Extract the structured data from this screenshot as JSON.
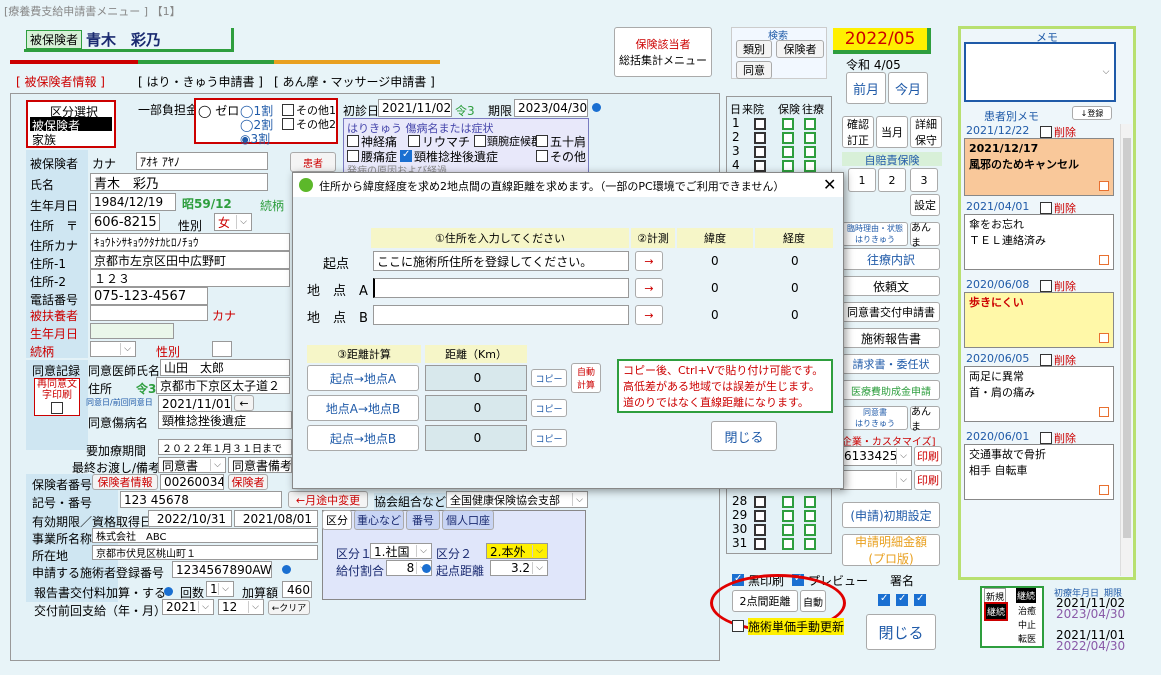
{
  "window_title": "[療養費支給申請書メニュー ]  【1】",
  "patient": {
    "label": "被保険者",
    "name": "青木　彩乃"
  },
  "menu_button": {
    "line1": "保険該当者",
    "line2": "総括集計メニュー"
  },
  "search": {
    "title": "検索",
    "b1": "類別",
    "b2": "保険者",
    "b3": "同意"
  },
  "date_badge": "2022/05",
  "era_date": "令和 4/05",
  "tabs": [
    "[ 被保険者情報 ]",
    "[ はり・きゅう申請書 ]",
    "[ あん摩・マッサージ申請書 ]"
  ],
  "kubun": {
    "title": "区分選択",
    "opt1": "被保険者",
    "opt2": "家族"
  },
  "futan": {
    "label": "一部負担金",
    "r0": "ゼロ",
    "r1": "1割",
    "r2": "2割",
    "r3": "3割",
    "o1": "その他1",
    "o2": "その他2"
  },
  "shoken": {
    "label": "初診日",
    "date": "2021/11/02",
    "era": "令3",
    "kigen_label": "期限",
    "kigen": "2023/04/30"
  },
  "shobyo": {
    "title": "はりきゅう 傷病名または症状",
    "c1": "神経痛",
    "c2": "リウマチ",
    "c3": "頸腕症候群",
    "c4": "五十肩",
    "c5": "腰痛症",
    "c6": "頸椎捻挫後遺症",
    "c7": "その他",
    "c8": "発病の原因および経過"
  },
  "fields": {
    "hihoken": "被保険者",
    "kana_label": "カナ",
    "kana": "ｱｵｷ ｱﾔﾉ",
    "name_label": "氏名",
    "name": "青木　彩乃",
    "birth_label": "生年月日",
    "birth": "1984/12/19",
    "birth_era": "昭59/12",
    "zokugara": "続柄",
    "addr_label": "住所　〒",
    "zip": "606-8215",
    "sex_label": "性別",
    "sex": "女",
    "addr_kana_label": "住所カナ",
    "addr_kana": "ｷｮｳﾄｼｻｷｮｳｸﾀﾅｶﾋﾛﾉﾁｮｳ",
    "addr1_label": "住所-1",
    "addr1": "京都市左京区田中広野町",
    "addr2_label": "住所-2",
    "addr2": "１２３",
    "tel_label": "電話番号",
    "tel": "075-123-4567",
    "fuyo_label": "被扶養者",
    "kana2": "カナ",
    "birth2": "生年月日",
    "zoku2": "続柄",
    "sex2": "性別",
    "patient_btn": "患者"
  },
  "doi": {
    "record": "同意記録",
    "doctor_label": "同意医師氏名",
    "doctor": "山田　太郎",
    "print_label": "再同意文字印刷",
    "addr_label": "住所",
    "addr_era": "令3",
    "addr": "京都市下京区太子道２",
    "date_label": "同意日/前回同意日",
    "date": "2021/11/01",
    "byomei_label": "同意傷病名",
    "byomei": "頸椎捻挫後遺症",
    "yokaryo_label": "要加療期間",
    "yokaryo": "２０２２年１月３１日まで",
    "saishu_label": "最終お渡し/備考",
    "saishu": "同意書",
    "saishu2": "同意書備考"
  },
  "hoken": {
    "no_label": "保険者番号",
    "no_btn": "保険者情報",
    "no": "00260034",
    "hokensha": "保険者",
    "kigo_label": "記号・番号",
    "kigo": "123 45678",
    "tochu": "←月途中変更",
    "kumiai_label": "協会組合など",
    "kumiai": "全国健康保険協会支部",
    "yuko_label": "有効期限／資格取得日",
    "yuko1": "2022/10/31",
    "yuko2": "2021/08/01",
    "jigyo_label": "事業所名称",
    "jigyo": "株式会社　ABC",
    "shozai_label": "所在地",
    "shozai": "京都市伏見区桃山町１",
    "sekou_label": "申請する施術者登録番号",
    "sekou": "1234567890AW",
    "hokoku_label": "報告書交付料加算・する",
    "kaisu_label": "回数",
    "kaisu": "1",
    "kasan_label": "加算額",
    "kasan": "460",
    "zenkai_label": "交付前回支給（年・月）",
    "zen_y": "2021",
    "zen_m": "12",
    "clear": "←クリア"
  },
  "subtabs": [
    "区分",
    "重心など",
    "番号",
    "個人口座"
  ],
  "kubun_panel": {
    "k1_label": "区分１",
    "k1": "1.社国",
    "k2_label": "区分２",
    "k2": "2.本外",
    "kyufu_label": "給付割合",
    "kyufu": "8",
    "kiten_label": "起点距離",
    "kiten": "3.2"
  },
  "calendar": {
    "h1": "日",
    "h2": "来院",
    "h3": "保険",
    "h4": "往療",
    "days": [
      "1",
      "2",
      "3",
      "4",
      "28",
      "29",
      "30",
      "31"
    ]
  },
  "right_menu": {
    "kakunin": "確認",
    "teisei": "訂正",
    "tougetsu": "当月",
    "shosai": "詳細",
    "hozon": "保守",
    "jibai": "自賠責保険",
    "j1": "1",
    "j2": "2",
    "j3": "3",
    "settei": "設定",
    "riyu": "臨時理由・状態",
    "hari1": "はりきゅう",
    "anma1": "あんま",
    "ouryo": "往療内訳",
    "irai": "依頼文",
    "doisho": "同意書交付申請書",
    "hokokusho": "施術報告書",
    "seikyu": "請求書・委任状",
    "iryohi": "医療費助成金申請",
    "doisho2": "同意書",
    "hari2": "はりきゅう",
    "anma2": "あんま",
    "kigyo": "[企業・カスタマイズ]",
    "code": "6133425",
    "insatsu": "印刷",
    "insatsu2": "印刷",
    "shoki": "(申請)初期設定",
    "meisai1": "申請明細金額",
    "meisai2": "(プロ版)",
    "kuro": "黒印刷",
    "preview": "プレビュー",
    "shomei": "署名",
    "kyori": "2点間距離",
    "jido": "自動",
    "tanka": "施術単価手動更新",
    "close": "閉じる",
    "prev_month": "前月",
    "this_month": "今月"
  },
  "memo": {
    "title": "メモ",
    "patient_memo": "患者別メモ",
    "touroku": "↓登録",
    "entries": [
      {
        "date": "2021/12/22",
        "del": "削除",
        "l1": "2021/12/17",
        "l2": "風邪のためキャンセル"
      },
      {
        "date": "2021/04/01",
        "del": "削除",
        "l1": "傘をお忘れ",
        "l2": "ＴＥＬ連絡済み"
      },
      {
        "date": "2020/06/08",
        "del": "削除",
        "l1": "歩きにくい",
        "l2": ""
      },
      {
        "date": "2020/06/05",
        "del": "削除",
        "l1": "両足に異常",
        "l2": "首・肩の痛み"
      },
      {
        "date": "2020/06/01",
        "del": "削除",
        "l1": "交通事故で骨折",
        "l2": "相手 自転車"
      }
    ]
  },
  "status": {
    "shinki": "新規",
    "keizoku": "継続",
    "keizoku2": "継続",
    "chiyu": "治癒",
    "chushi": "中止",
    "tenin": "転医",
    "shoryo_label": "初療年月日",
    "kigen_label": "期限",
    "d1": "2021/11/02",
    "d2": "2023/04/30",
    "d3": "2021/11/01",
    "d4": "2022/04/30"
  },
  "dialog": {
    "title": "住所から緯度経度を求め2地点間の直線距離を求めます。（一部のPC環境でご利用できません）",
    "h_addr": "①住所を入力してください",
    "h_calc": "②計測",
    "h_lat": "緯度",
    "h_lng": "経度",
    "r1_label": "起点",
    "r1_value": "ここに施術所住所を登録してください。",
    "r1_lat": "0",
    "r1_lng": "0",
    "r2_label": "地　点　A",
    "r2_value": "",
    "r2_lat": "0",
    "r2_lng": "0",
    "r3_label": "地　点　B",
    "r3_value": "",
    "r3_lat": "0",
    "r3_lng": "0",
    "arrow": "→",
    "h_dist_calc": "③距離計算",
    "h_dist": "距離（Km）",
    "d1": "起点→地点A",
    "d2": "地点A→地点B",
    "d3": "起点→地点B",
    "v1": "0",
    "v2": "0",
    "v3": "0",
    "copy": "コピー",
    "auto1": "自動",
    "auto2": "計算",
    "note1": "コピー後、Ctrl+Vで貼り付け可能です。",
    "note2": "高低差がある地域では誤差が生じます。",
    "note3": "道のりではなく直線距離になります。",
    "close": "閉じる"
  },
  "colors": {
    "accent_red": "#cc0000",
    "tab_green": "#2e9e3e",
    "tab_orange": "#e8a020",
    "date_yellow": "#fff000",
    "overlay": "#e9f3f8"
  }
}
